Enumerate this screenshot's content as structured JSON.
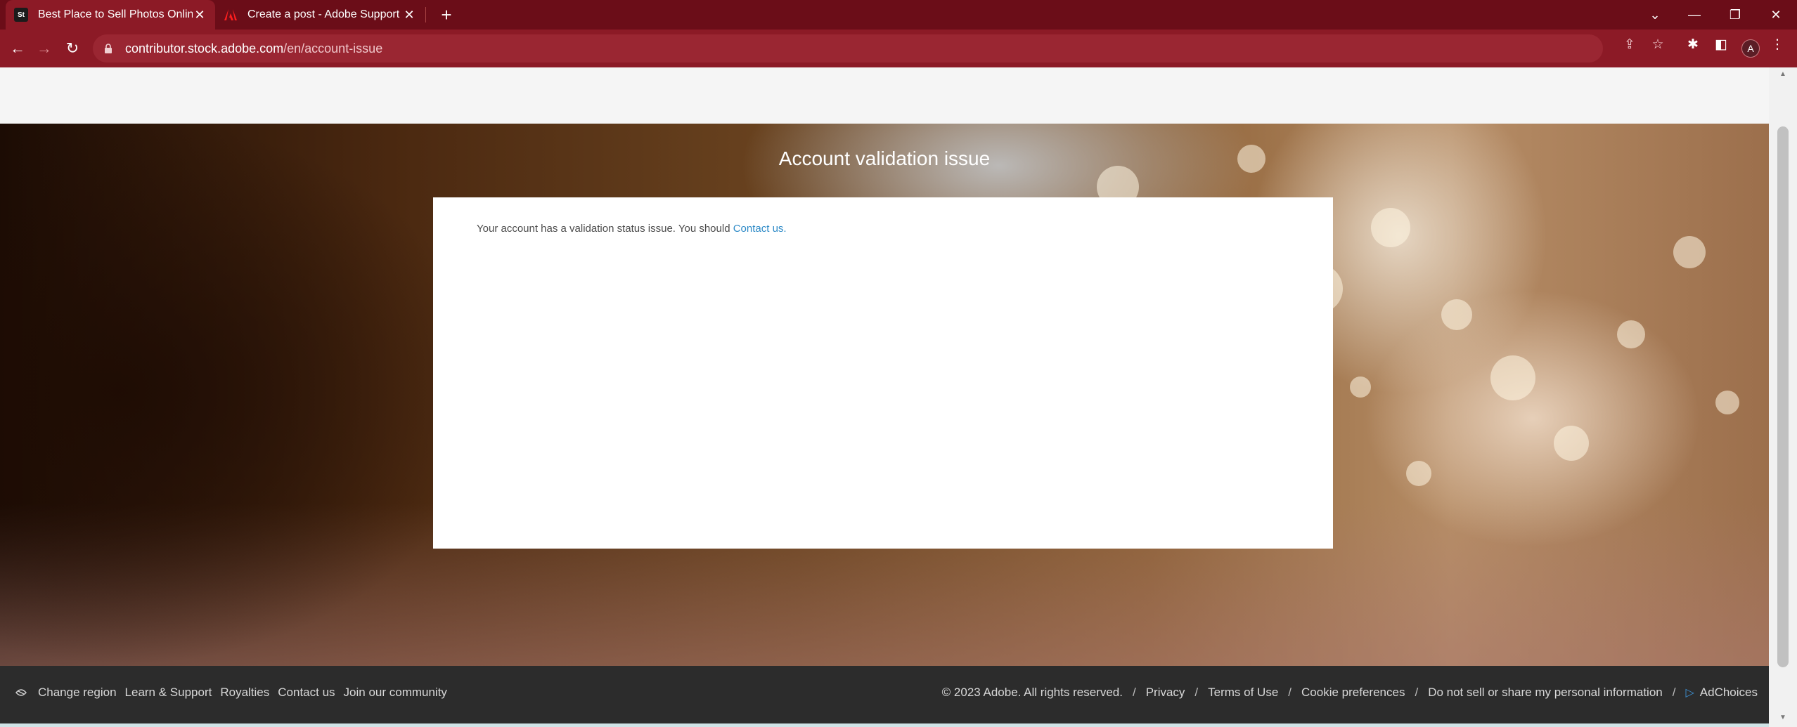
{
  "browser": {
    "tabs": [
      {
        "title": "Best Place to Sell Photos Online, Ad",
        "favicon": "St",
        "close": "✕",
        "active": true
      },
      {
        "title": "Create a post - Adobe Support Com",
        "favicon": "adobe-logo",
        "close": "✕",
        "active": false
      }
    ],
    "new_tab_label": "+",
    "url_host": "contributor.stock.adobe.com",
    "url_path": "/en/account-issue",
    "profile_initial": "A",
    "theme_color": "#8c1a26"
  },
  "page": {
    "title": "Account validation issue",
    "message": "Your account has a validation status issue. You should ",
    "contact_link": "Contact us."
  },
  "footer": {
    "left_links": [
      "Change region",
      "Learn & Support",
      "Royalties",
      "Contact us",
      "Join our community"
    ],
    "copyright": "© 2023 Adobe. All rights reserved.",
    "right_links": [
      "Privacy",
      "Terms of Use",
      "Cookie preferences",
      "Do not sell or share my personal information",
      "AdChoices"
    ],
    "separator": "/"
  }
}
